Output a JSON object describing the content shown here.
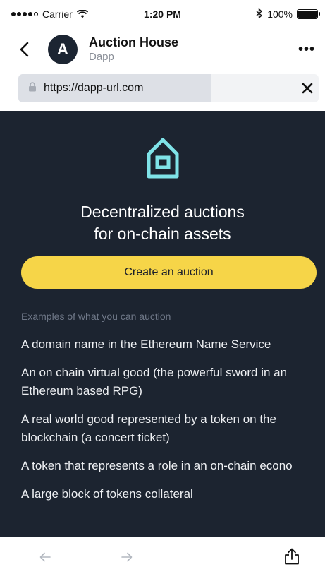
{
  "status_bar": {
    "carrier": "Carrier",
    "time": "1:20 PM",
    "battery": "100%",
    "battery_level": 1.0
  },
  "header": {
    "avatar_letter": "A",
    "title": "Auction House",
    "subtitle": "Dapp",
    "more_label": "•••"
  },
  "url_bar": {
    "url": "https://dapp-url.com"
  },
  "content": {
    "hero_title_line1": "Decentralized auctions",
    "hero_title_line2": "for on-chain assets",
    "cta_label": "Create an auction",
    "examples_heading": "Examples of what you can auction",
    "examples": [
      "A domain name in the Ethereum Name Service",
      "An on chain virtual good (the powerful sword in an Ethereum based RPG)",
      "A real world good represented by a token on the blockchain (a concert ticket)",
      "A token that represents a role in an on-chain econo",
      "A large block of tokens collateral"
    ]
  },
  "colors": {
    "content_bg": "#1c2430",
    "accent_yellow": "#f6d548",
    "house_icon": "#7fe3e8"
  },
  "icons": {
    "back": "chevron-left-icon",
    "lock": "lock-icon",
    "close": "close-icon",
    "house": "house-icon",
    "nav_back": "arrow-left-icon",
    "nav_forward": "arrow-right-icon",
    "share": "share-icon"
  }
}
